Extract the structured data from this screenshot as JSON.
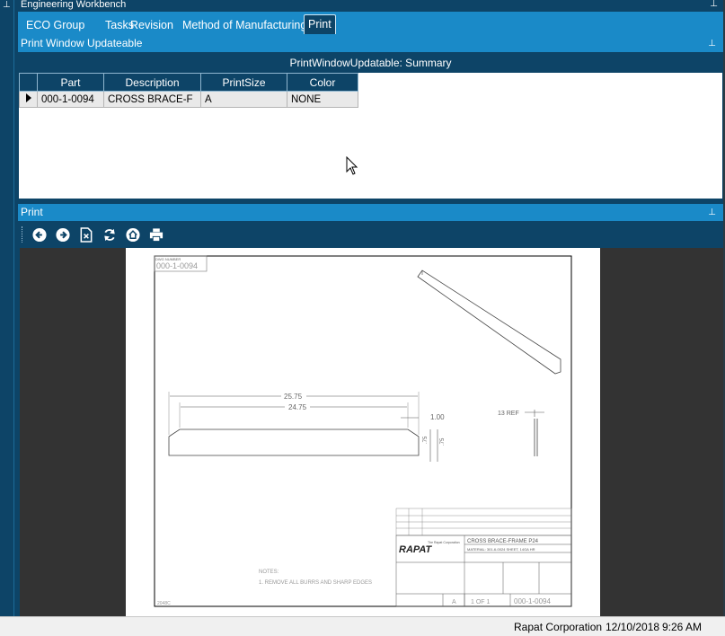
{
  "app": {
    "workbench_title": "Engineering Workbench"
  },
  "tabs": [
    {
      "label": "ECO Group"
    },
    {
      "label": "Tasks"
    },
    {
      "label": "Revision"
    },
    {
      "label": "Method of Manufacturing"
    },
    {
      "label": "Print",
      "active": true
    }
  ],
  "print_window_panel": {
    "title": "Print Window Updateable",
    "grid_caption": "PrintWindowUpdatable: Summary",
    "columns": [
      "Part",
      "Description",
      "PrintSize",
      "Color"
    ],
    "rows": [
      {
        "part": "000-1-0094",
        "description": "CROSS BRACE-F",
        "print_size": "A",
        "color": "NONE"
      }
    ]
  },
  "print_panel": {
    "title": "Print",
    "toolbar": [
      "back-icon",
      "forward-icon",
      "close-document-icon",
      "refresh-icon",
      "home-icon",
      "print-icon"
    ]
  },
  "drawing": {
    "dwg_label": "DWG NUMBER",
    "dwg_number": "000-1-0094",
    "dim_overall": "25.75",
    "dim_inner": "24.75",
    "dim_end": "1.00",
    "dim_height_a": ".75",
    "dim_height_b": ".75",
    "dim_ref": "13 REF",
    "notes_title": "NOTES:",
    "note_1": "1. REMOVE ALL BURRS AND SHARP EDGES",
    "company_logo_text": "RAPAT",
    "company_block": "The Rapat Corporation",
    "title": "CROSS BRACE-FRAME P24",
    "material": "MATERIAL: 301-6-0024 SHEET, 14GA HR",
    "size": "A",
    "sheet": "1 OF 1",
    "drawing_number_box": "000-1-0094",
    "corner_label": "2048C"
  },
  "status_bar": {
    "company": "Rapat Corporation",
    "date": "12/10/2018",
    "time": "9:26 AM"
  },
  "colors": {
    "navy": "#0d4467",
    "accent_blue": "#1a8ac8",
    "viewer_bg": "#333333"
  }
}
